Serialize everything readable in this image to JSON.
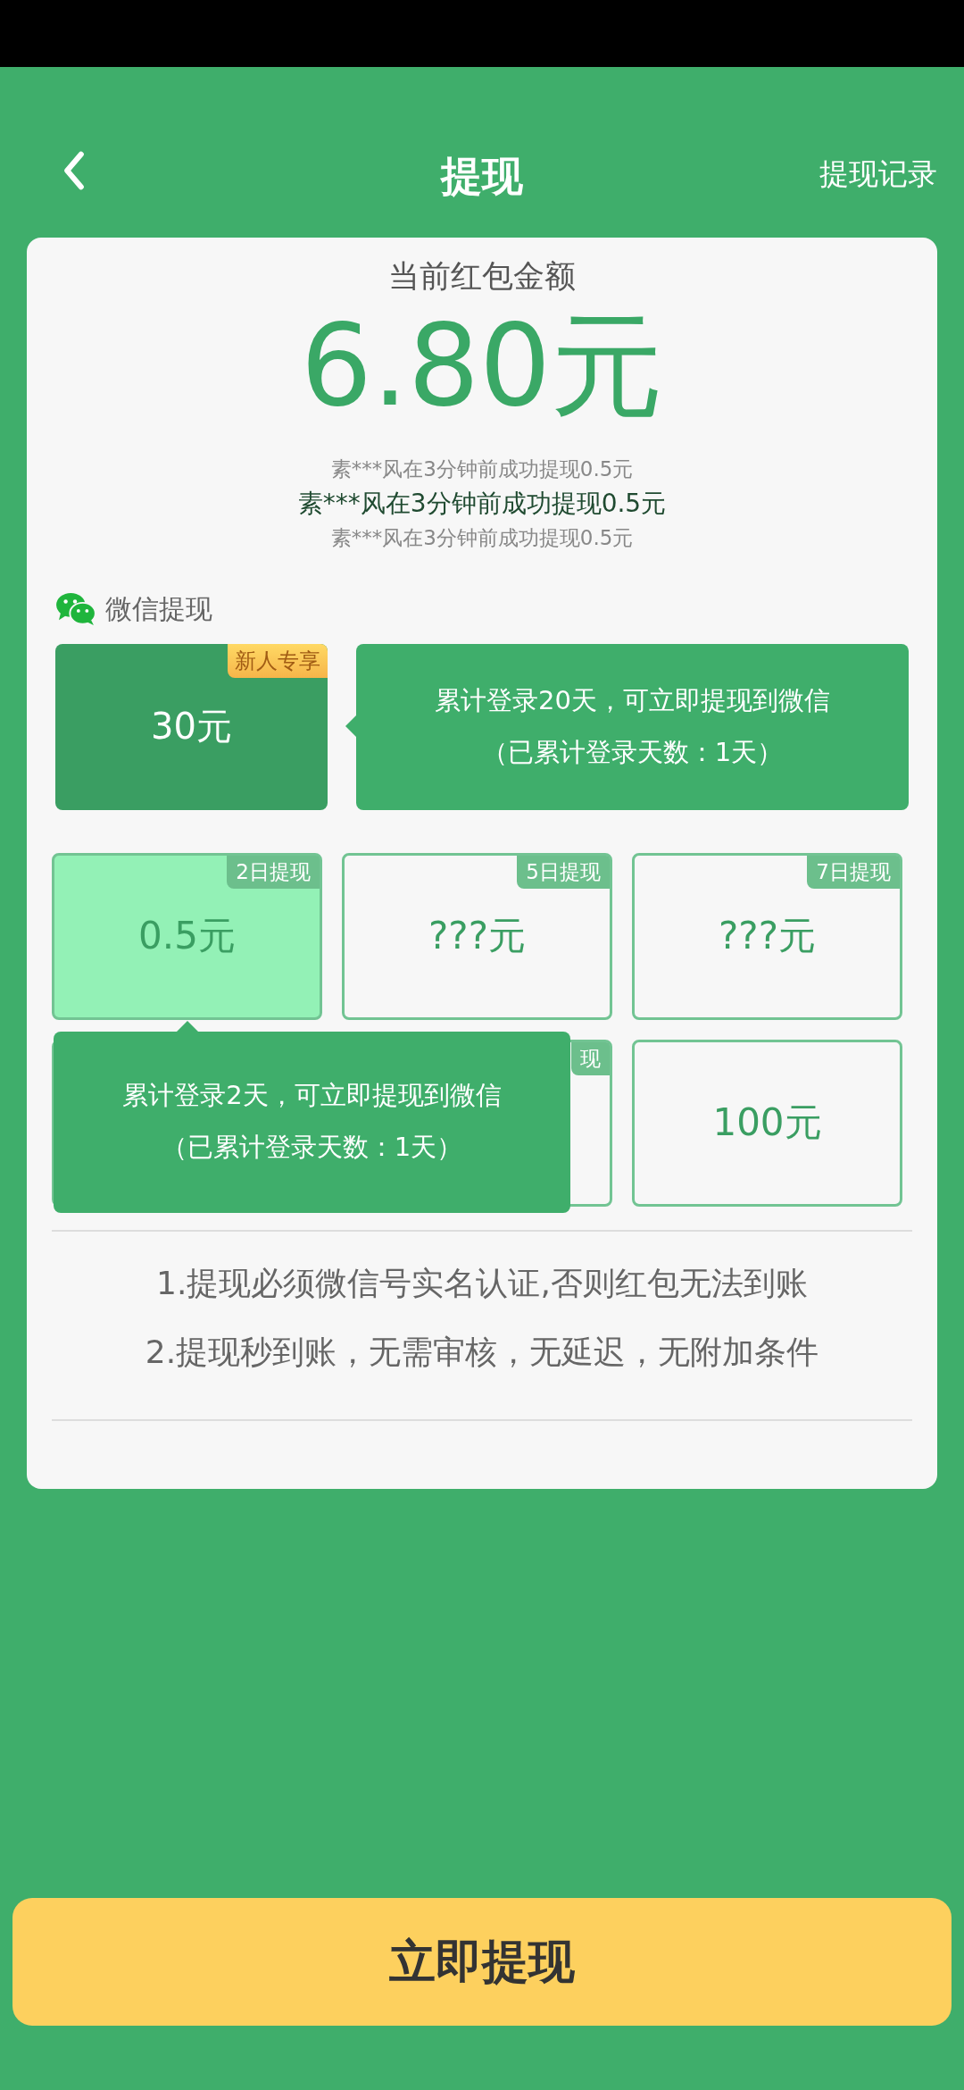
{
  "header": {
    "title": "提现",
    "records_link": "提现记录"
  },
  "balance": {
    "label": "当前红包金额",
    "amount": "6.80元"
  },
  "ticker": [
    {
      "text": "素***风在3分钟前成功提现0.5元",
      "selected": false
    },
    {
      "text": "素***风在3分钟前成功提现0.5元",
      "selected": true
    },
    {
      "text": "素***风在3分钟前成功提现0.5元",
      "selected": false
    }
  ],
  "section_title": "微信提现",
  "newcomer": {
    "amount": "30元",
    "badge": "新人专享",
    "tip_lines": [
      "累计登录20天，可立即提现到微信",
      "（已累计登录天数：1天）"
    ]
  },
  "tiles": [
    {
      "kind": "tile",
      "amount": "0.5元",
      "tag": "2日提现",
      "selected": true
    },
    {
      "kind": "tile",
      "amount": "???元",
      "tag": "5日提现",
      "selected": false
    },
    {
      "kind": "tile",
      "amount": "???元",
      "tag": "7日提现",
      "selected": false
    },
    {
      "kind": "covered"
    },
    {
      "kind": "tile",
      "tag": "现",
      "selected": false
    },
    {
      "kind": "tile",
      "amount": "100元",
      "selected": false
    }
  ],
  "tile_tip": {
    "lines": [
      "累计登录2天，可立即提现到微信",
      "（已累计登录天数：1天）"
    ]
  },
  "rules": [
    "1.提现必须微信号实名认证,否则红包无法到账",
    "2.提现秒到账，无需审核，无延迟，无附加条件"
  ],
  "submit": "立即提现"
}
